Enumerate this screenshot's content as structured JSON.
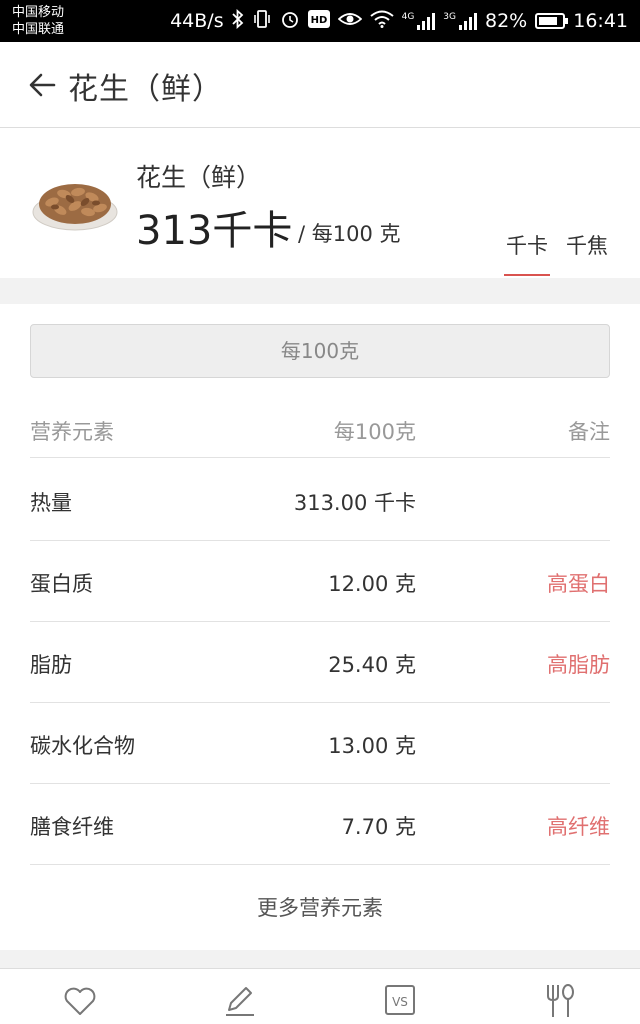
{
  "status_bar": {
    "carrier_1": "中国移动",
    "carrier_2": "中国联通",
    "speed": "44B/s",
    "signal_1_label": "4G",
    "signal_2_label": "3G",
    "battery": "82%",
    "battery_level": 0.82,
    "time": "16:41"
  },
  "header": {
    "title": "花生（鲜）"
  },
  "food": {
    "name": "花生（鲜）",
    "calories": "313千卡",
    "per_unit": "/ 每100 克",
    "unit_tabs": [
      "千卡",
      "千焦"
    ],
    "selected_unit": "千卡"
  },
  "basis_selector": "每100克",
  "table": {
    "headers": [
      "营养元素",
      "每100克",
      "备注"
    ],
    "rows": [
      {
        "name": "热量",
        "value": "313.00 千卡",
        "note": ""
      },
      {
        "name": "蛋白质",
        "value": "12.00 克",
        "note": "高蛋白"
      },
      {
        "name": "脂肪",
        "value": "25.40 克",
        "note": "高脂肪"
      },
      {
        "name": "碳水化合物",
        "value": "13.00 克",
        "note": ""
      },
      {
        "name": "膳食纤维",
        "value": "7.70 克",
        "note": "高纤维"
      }
    ]
  },
  "more_link": "更多营养元素",
  "colors": {
    "accent": "#d9534f",
    "note_red": "#e07070"
  },
  "bottom_tabs": [
    {
      "icon": "heart-icon"
    },
    {
      "icon": "pencil-icon"
    },
    {
      "icon": "vs-icon",
      "label": "VS"
    },
    {
      "icon": "fork-knife-icon"
    }
  ]
}
